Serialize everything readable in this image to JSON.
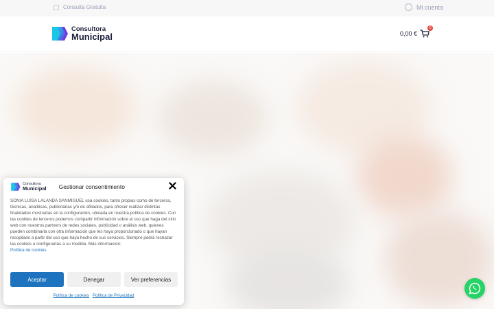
{
  "topbar": {
    "contact_label": "Consulta Gratuita",
    "account_label": "Mi cuenta"
  },
  "header": {
    "logo_line1": "Consultora",
    "logo_line2": "Municipal",
    "cart_total": "0,00 €",
    "cart_count": "0"
  },
  "consent": {
    "logo_line1": "Consultora",
    "logo_line2": "Municipal",
    "title": "Gestionar consentimiento",
    "body": "SONIA LUISA LALANDA SANMIGUEL usa cookies, tanto propias como de terceros, técnicas, analíticas, publicitarias y/o de afiliados, para ofrecer realizar distintas finalidades mostradas en la configuración, ubicada en nuestra política de cookies. Con las cookies de terceros podemos compartir información sobre el uso que haga del sitio web con nuestros partners de redes sociales, publicidad o análisis web, quienes pueden combinarla con otra información que les haya proporcionado o que hayan recopilado a partir del uso que haya hecho de sus servicios. Siempre podrá rechazar las cookies o configurarlas a su medida. Más información:",
    "body_link": "Política de cookies",
    "accept_label": "Aceptar",
    "deny_label": "Denegar",
    "prefs_label": "Ver preferencias",
    "footer_link_cookies": "Política de cookies",
    "footer_link_privacy": "Política de Privacidad"
  },
  "colors": {
    "brand_blue": "#1e73be",
    "logo_purple": "#6c3be4",
    "logo_cyan": "#19c6e6",
    "whatsapp": "#25d366",
    "badge_red": "#e4483f"
  }
}
